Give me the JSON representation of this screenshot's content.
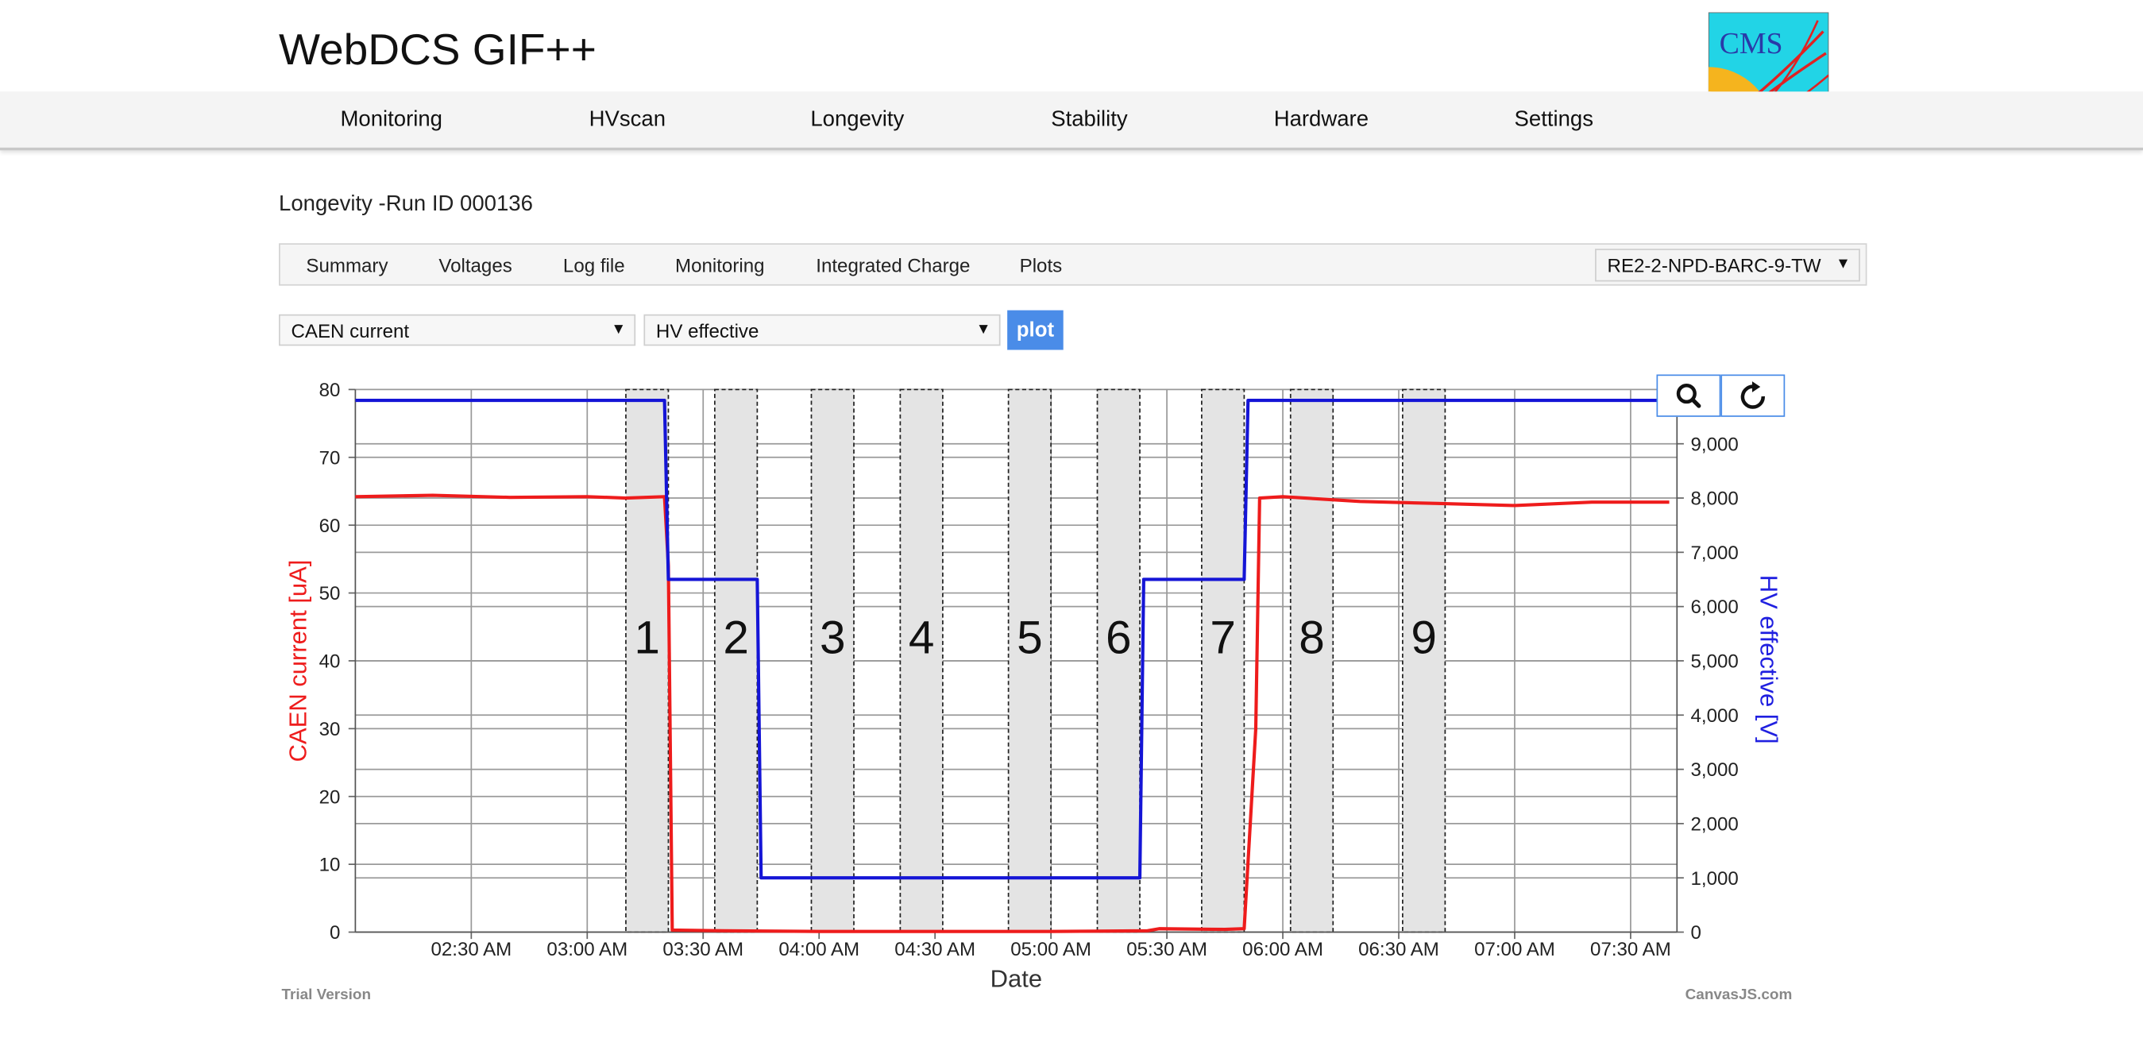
{
  "site": {
    "title": "WebDCS GIF++"
  },
  "logo": {
    "text": "CMS"
  },
  "nav": {
    "items": [
      "Monitoring",
      "HVscan",
      "Longevity",
      "Stability",
      "Hardware",
      "Settings"
    ]
  },
  "page": {
    "heading": "Longevity -Run ID 000136"
  },
  "subnav": {
    "items": [
      "Summary",
      "Voltages",
      "Log file",
      "Monitoring",
      "Integrated Charge",
      "Plots"
    ],
    "detector_select": "RE2-2-NPD-BARC-9-TW"
  },
  "controls": {
    "y1_select": "CAEN current",
    "y2_select": "HV effective",
    "plot_label": "plot"
  },
  "tools": {
    "zoom_icon": "search-icon",
    "reset_icon": "reset-icon"
  },
  "footer": {
    "trial": "Trial Version",
    "credit": "CanvasJS.com"
  },
  "chart_data": {
    "type": "line",
    "title": "",
    "xlabel": "Date",
    "ylabel": "CAEN current [uA]",
    "y2label": "HV effective [V]",
    "x_ticks": [
      "02:30 AM",
      "03:00 AM",
      "03:30 AM",
      "04:00 AM",
      "04:30 AM",
      "05:00 AM",
      "05:30 AM",
      "06:00 AM",
      "06:30 AM",
      "07:00 AM",
      "07:30 AM"
    ],
    "y_ticks": [
      "0",
      "10",
      "20",
      "30",
      "40",
      "50",
      "60",
      "70",
      "80"
    ],
    "y2_ticks": [
      "0",
      "1,000",
      "2,000",
      "3,000",
      "4,000",
      "5,000",
      "6,000",
      "7,000",
      "8,000",
      "9,000"
    ],
    "xlim": [
      "02:00 AM",
      "07:42 AM"
    ],
    "ylim": [
      0,
      80
    ],
    "y2lim": [
      0,
      10000
    ],
    "grid": true,
    "colors": {
      "current": "#ee1c1c",
      "hv": "#1515d6",
      "band": "#e4e4e4"
    },
    "series": [
      {
        "name": "CAEN current",
        "axis": "left",
        "points": [
          [
            "02:00",
            64.2
          ],
          [
            "02:20",
            64.4
          ],
          [
            "02:40",
            64.1
          ],
          [
            "03:00",
            64.2
          ],
          [
            "03:10",
            64.0
          ],
          [
            "03:20",
            64.2
          ],
          [
            "03:21",
            54.0
          ],
          [
            "03:22",
            0.3
          ],
          [
            "03:35",
            0.2
          ],
          [
            "04:00",
            0.1
          ],
          [
            "04:30",
            0.1
          ],
          [
            "05:00",
            0.1
          ],
          [
            "05:25",
            0.2
          ],
          [
            "05:28",
            0.5
          ],
          [
            "05:45",
            0.4
          ],
          [
            "05:50",
            0.5
          ],
          [
            "05:53",
            30.0
          ],
          [
            "05:54",
            64.0
          ],
          [
            "06:00",
            64.2
          ],
          [
            "06:20",
            63.5
          ],
          [
            "06:40",
            63.2
          ],
          [
            "07:00",
            62.9
          ],
          [
            "07:20",
            63.4
          ],
          [
            "07:40",
            63.4
          ]
        ]
      },
      {
        "name": "HV effective",
        "axis": "right",
        "points": [
          [
            "02:00",
            9800
          ],
          [
            "03:20",
            9800
          ],
          [
            "03:21",
            6500
          ],
          [
            "03:44",
            6500
          ],
          [
            "03:45",
            1000
          ],
          [
            "05:23",
            1000
          ],
          [
            "05:24",
            6500
          ],
          [
            "05:50",
            6500
          ],
          [
            "05:51",
            9800
          ],
          [
            "07:40",
            9800
          ]
        ]
      }
    ],
    "bands": [
      {
        "label": "1",
        "start": "03:10",
        "end": "03:21"
      },
      {
        "label": "2",
        "start": "03:33",
        "end": "03:44"
      },
      {
        "label": "3",
        "start": "03:58",
        "end": "04:09"
      },
      {
        "label": "4",
        "start": "04:21",
        "end": "04:32"
      },
      {
        "label": "5",
        "start": "04:49",
        "end": "05:00"
      },
      {
        "label": "6",
        "start": "05:12",
        "end": "05:23"
      },
      {
        "label": "7",
        "start": "05:39",
        "end": "05:50"
      },
      {
        "label": "8",
        "start": "06:02",
        "end": "06:13"
      },
      {
        "label": "9",
        "start": "06:31",
        "end": "06:42"
      }
    ],
    "legend": "none"
  }
}
